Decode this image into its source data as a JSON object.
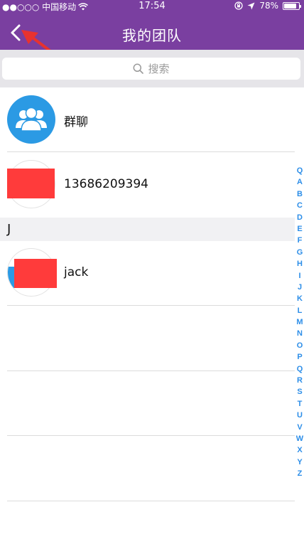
{
  "status_bar": {
    "carrier": "●●○○○ 中国移动",
    "time": "17:54",
    "battery_text": "78%",
    "battery_level": 0.78
  },
  "nav": {
    "title": "我的团队"
  },
  "search": {
    "placeholder": "搜索"
  },
  "contacts": {
    "group_chat_label": "群聊",
    "phone_contact_label": "13686209394",
    "section_j_letter": "J",
    "jack_label": "jack"
  },
  "index_letters": [
    "Q",
    "A",
    "B",
    "C",
    "D",
    "E",
    "F",
    "G",
    "H",
    "I",
    "J",
    "K",
    "L",
    "M",
    "N",
    "O",
    "P",
    "Q",
    "R",
    "S",
    "T",
    "U",
    "V",
    "W",
    "X",
    "Y",
    "Z"
  ],
  "colors": {
    "header": "#7a3fa0",
    "accent_blue": "#2d8ee8",
    "annotation_red": "#e8322f",
    "redaction": "#ff3b3b"
  },
  "icons": {
    "back": "chevron-left",
    "search": "magnifier",
    "group": "group-people",
    "wifi": "wifi",
    "location": "location-arrow",
    "lock_rotation": "rotation-lock"
  }
}
